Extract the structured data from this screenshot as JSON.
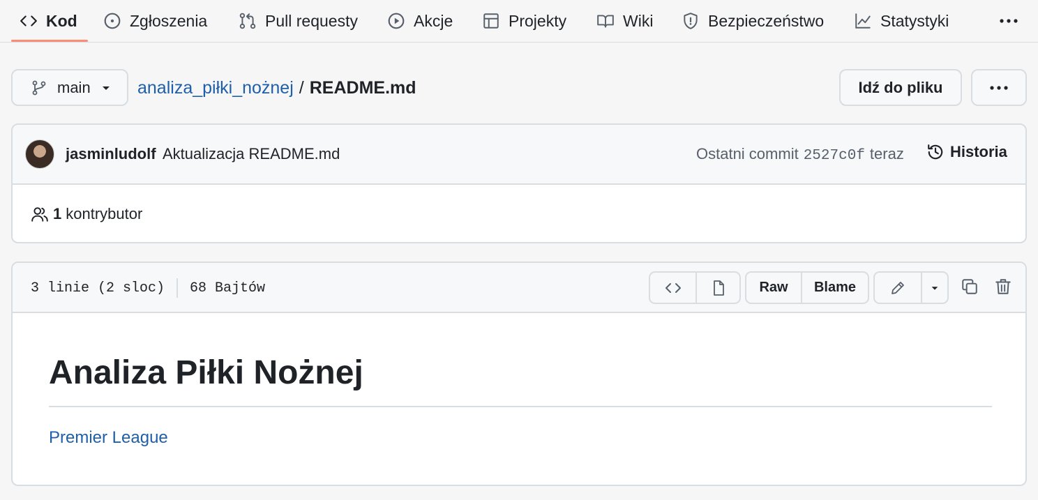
{
  "nav": {
    "items": [
      {
        "label": "Kod",
        "icon": "code-icon",
        "active": true
      },
      {
        "label": "Zgłoszenia",
        "icon": "issue-icon"
      },
      {
        "label": "Pull requesty",
        "icon": "pull-request-icon"
      },
      {
        "label": "Akcje",
        "icon": "play-icon"
      },
      {
        "label": "Projekty",
        "icon": "table-icon"
      },
      {
        "label": "Wiki",
        "icon": "book-icon"
      },
      {
        "label": "Bezpieczeństwo",
        "icon": "shield-icon"
      },
      {
        "label": "Statystyki",
        "icon": "graph-icon"
      }
    ],
    "more_icon": "kebab-horizontal-icon",
    "accent_color": "#fd8c73"
  },
  "path": {
    "branch": "main",
    "repo": "analiza_piłki_nożnej",
    "separator": "/",
    "file": "README.md",
    "goto_file": "Idź do pliku"
  },
  "commit": {
    "author": "jasminludolf",
    "message": "Aktualizacja README.md",
    "last_commit_label": "Ostatni commit",
    "sha": "2527c0f",
    "time": "teraz",
    "history_label": "Historia",
    "contributors_count": "1",
    "contributors_label": "kontrybutor"
  },
  "file": {
    "lines": "3 linie (2 sloc)",
    "size": "68 Bajtów",
    "raw_label": "Raw",
    "blame_label": "Blame"
  },
  "readme": {
    "heading": "Analiza Piłki Nożnej",
    "link": "Premier League",
    "link_color": "#1f5faa"
  }
}
